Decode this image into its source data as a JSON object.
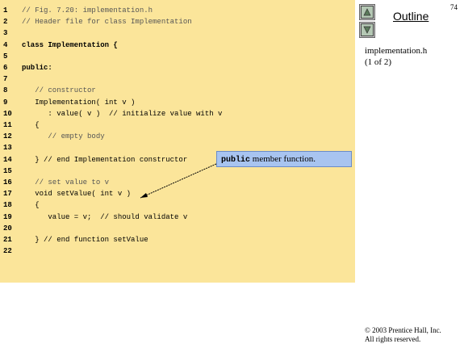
{
  "page_number": "74",
  "sidebar": {
    "outline_title": "Outline",
    "file_name": "implementation.h",
    "file_part": "(1 of 2)",
    "up_button_icon": "triangle-up-icon",
    "down_button_icon": "triangle-down-icon"
  },
  "code_lines": [
    {
      "num": "1",
      "text": "// Fig. 7.20: implementation.h"
    },
    {
      "num": "2",
      "text": "// Header file for class Implementation"
    },
    {
      "num": "3",
      "text": ""
    },
    {
      "num": "4",
      "text": "class Implementation {"
    },
    {
      "num": "5",
      "text": ""
    },
    {
      "num": "6",
      "text": "public:"
    },
    {
      "num": "7",
      "text": ""
    },
    {
      "num": "8",
      "text": "   // constructor"
    },
    {
      "num": "9",
      "text": "   Implementation( int v )"
    },
    {
      "num": "10",
      "text": "      : value( v )  // initialize value with v"
    },
    {
      "num": "11",
      "text": "   {"
    },
    {
      "num": "12",
      "text": "      // empty body"
    },
    {
      "num": "13",
      "text": ""
    },
    {
      "num": "14",
      "text": "   } // end Implementation constructor"
    },
    {
      "num": "15",
      "text": ""
    },
    {
      "num": "16",
      "text": "   // set value to v"
    },
    {
      "num": "17",
      "text": "   void setValue( int v )"
    },
    {
      "num": "18",
      "text": "   {"
    },
    {
      "num": "19",
      "text": "      value = v;  // should validate v"
    },
    {
      "num": "20",
      "text": ""
    },
    {
      "num": "21",
      "text": "   } // end function setValue"
    },
    {
      "num": "22",
      "text": ""
    }
  ],
  "callout": {
    "keyword": "public",
    "text": " member function."
  },
  "copyright": {
    "line1": "© 2003 Prentice Hall, Inc.",
    "line2": "All rights reserved."
  },
  "colors": {
    "code_background": "#fbe59a",
    "callout_background": "#a8c4f0"
  }
}
